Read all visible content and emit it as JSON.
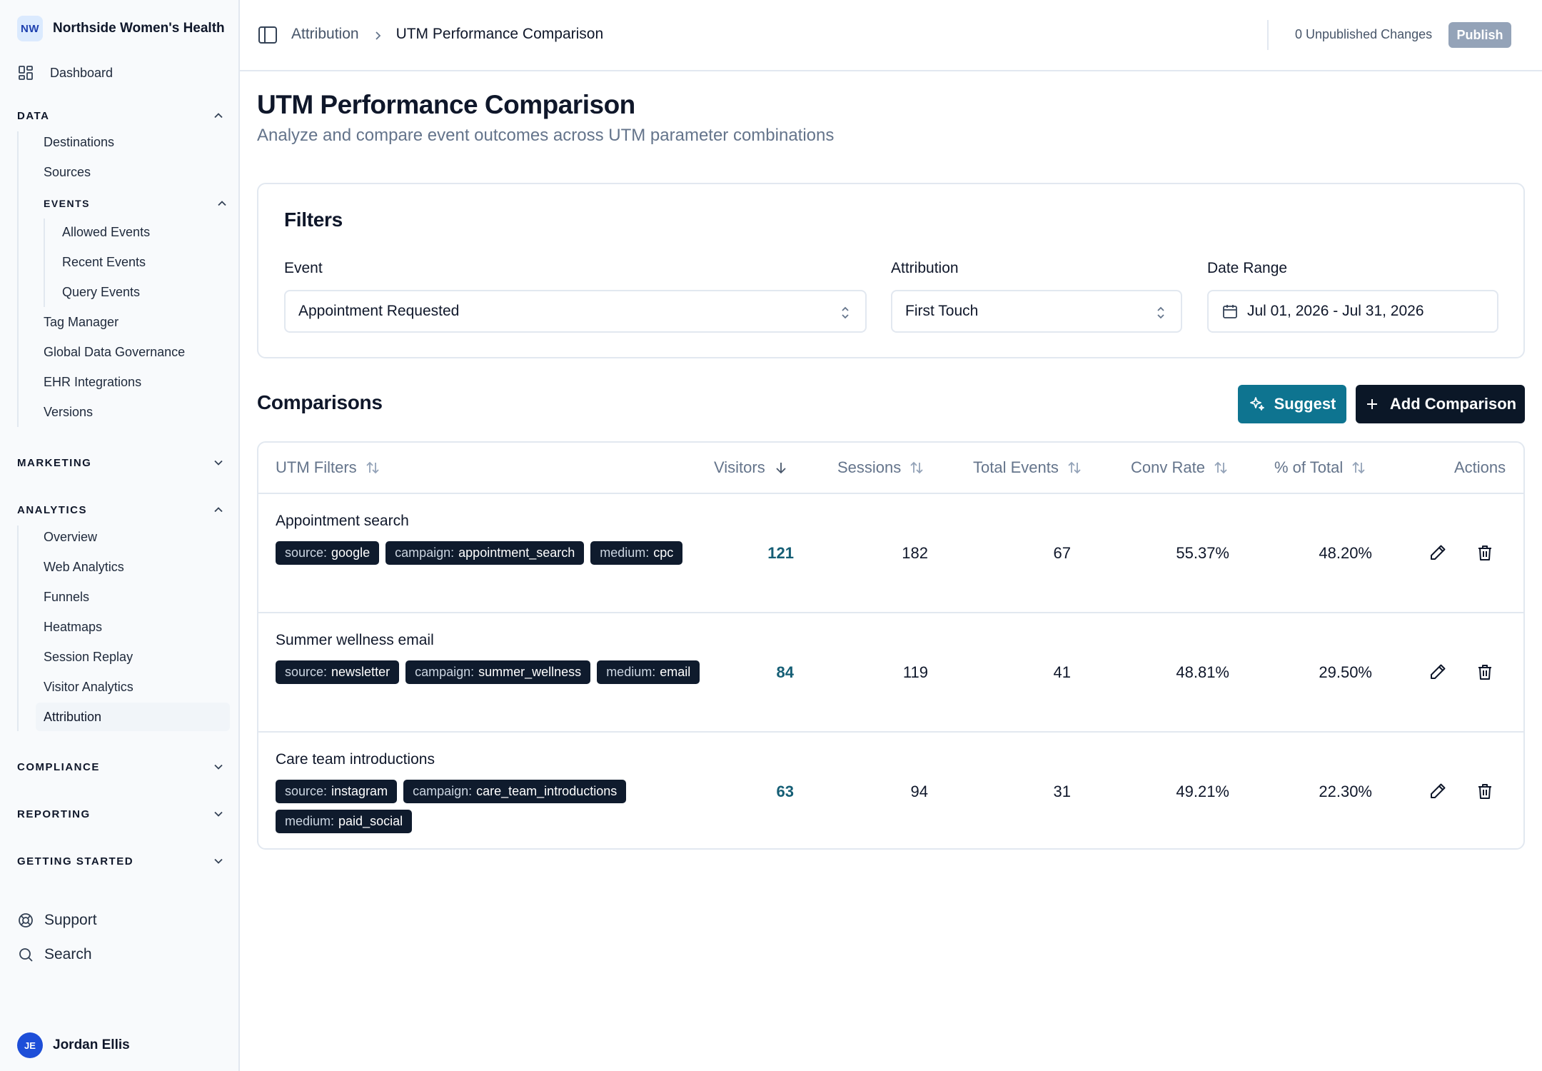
{
  "org": {
    "initials": "NW",
    "name": "Northside Women's Health"
  },
  "sidebar": {
    "dashboard": "Dashboard",
    "data": {
      "title": "DATA",
      "items": [
        "Destinations",
        "Sources"
      ],
      "events": {
        "title": "EVENTS",
        "items": [
          "Allowed Events",
          "Recent Events",
          "Query Events"
        ]
      },
      "items_after": [
        "Tag Manager",
        "Global Data Governance",
        "EHR Integrations",
        "Versions"
      ]
    },
    "marketing": {
      "title": "MARKETING"
    },
    "analytics": {
      "title": "ANALYTICS",
      "items": [
        "Overview",
        "Web Analytics",
        "Funnels",
        "Heatmaps",
        "Session Replay",
        "Visitor Analytics",
        "Attribution"
      ],
      "active": "Attribution"
    },
    "compliance": {
      "title": "COMPLIANCE"
    },
    "reporting": {
      "title": "REPORTING"
    },
    "getting_started": {
      "title": "GETTING STARTED"
    },
    "support": "Support",
    "search": "Search",
    "user": {
      "initials": "JE",
      "name": "Jordan Ellis"
    }
  },
  "topbar": {
    "breadcrumb_parent": "Attribution",
    "breadcrumb_current": "UTM Performance Comparison",
    "unpublished": "0 Unpublished Changes",
    "publish": "Publish"
  },
  "page": {
    "title": "UTM Performance Comparison",
    "subtitle": "Analyze and compare event outcomes across UTM parameter combinations"
  },
  "filters": {
    "title": "Filters",
    "event": {
      "label": "Event",
      "value": "Appointment Requested"
    },
    "attribution": {
      "label": "Attribution",
      "value": "First Touch"
    },
    "date_range": {
      "label": "Date Range",
      "value": "Jul 01, 2026 - Jul 31, 2026"
    }
  },
  "comparisons": {
    "title": "Comparisons",
    "suggest": "Suggest",
    "add": "Add Comparison",
    "columns": {
      "utm": "UTM Filters",
      "visitors": "Visitors",
      "sessions": "Sessions",
      "events": "Total Events",
      "conv": "Conv Rate",
      "pct": "% of Total",
      "actions": "Actions"
    },
    "rows": [
      {
        "name": "Appointment search",
        "tags": [
          {
            "k": "source:",
            "v": "google"
          },
          {
            "k": "campaign:",
            "v": "appointment_search"
          },
          {
            "k": "medium:",
            "v": "cpc"
          }
        ],
        "visitors": "121",
        "sessions": "182",
        "events": "67",
        "conv": "55.37%",
        "pct": "48.20%"
      },
      {
        "name": "Summer wellness email",
        "tags": [
          {
            "k": "source:",
            "v": "newsletter"
          },
          {
            "k": "campaign:",
            "v": "summer_wellness"
          },
          {
            "k": "medium:",
            "v": "email"
          }
        ],
        "visitors": "84",
        "sessions": "119",
        "events": "41",
        "conv": "48.81%",
        "pct": "29.50%"
      },
      {
        "name": "Care team introductions",
        "tags": [
          {
            "k": "source:",
            "v": "instagram"
          },
          {
            "k": "campaign:",
            "v": "care_team_introductions"
          },
          {
            "k": "medium:",
            "v": "paid_social"
          }
        ],
        "visitors": "63",
        "sessions": "94",
        "events": "31",
        "conv": "49.21%",
        "pct": "22.30%"
      }
    ]
  },
  "colors": {
    "accent": "#0e7490",
    "primary": "#0b1727",
    "tag_bg": "#0f1b2d",
    "visitors": "#155e75"
  }
}
